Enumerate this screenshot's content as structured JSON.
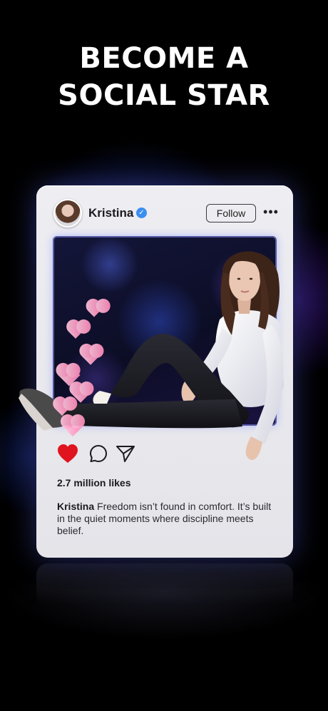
{
  "headline": {
    "line1": "BECOME A",
    "line2": "SOCIAL STAR"
  },
  "post": {
    "username": "Kristina",
    "verified_icon": "verified-badge-icon",
    "follow_label": "Follow",
    "more_icon": "more-options-icon",
    "likes_text": "2.7 million likes",
    "caption_user": "Kristina",
    "caption_text": " Freedom isn’t found in comfort. It’s built in the quiet moments where discipline meets belief.",
    "actions": [
      "heart-icon",
      "comment-icon",
      "share-icon"
    ],
    "liked": true
  },
  "colors": {
    "background": "#000000",
    "card": "#ececf0",
    "like_red": "#e0141e",
    "verified_blue": "#3b8ff0",
    "glow": "#5a60dc",
    "hearts": "#ff8fbf"
  }
}
